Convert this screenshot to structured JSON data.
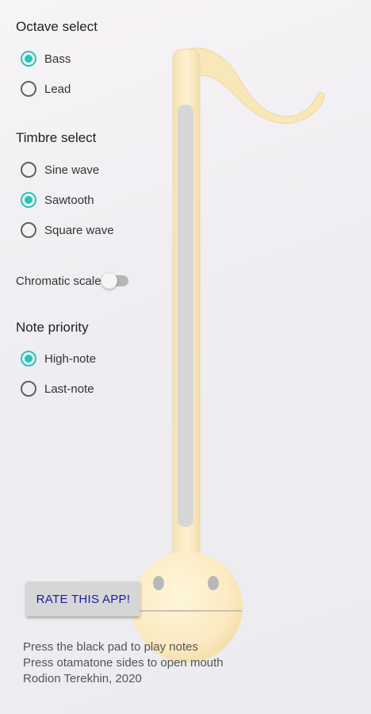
{
  "colors": {
    "accent": "#26c6b8",
    "button_text": "#1a1aa6",
    "otamatone_body": "#fbefcb",
    "stem_pad": "#d6d6d6"
  },
  "octave": {
    "title": "Octave select",
    "options": [
      {
        "label": "Bass",
        "checked": true
      },
      {
        "label": "Lead",
        "checked": false
      }
    ]
  },
  "timbre": {
    "title": "Timbre select",
    "options": [
      {
        "label": "Sine wave",
        "checked": false
      },
      {
        "label": "Sawtooth",
        "checked": true
      },
      {
        "label": "Square wave",
        "checked": false
      }
    ]
  },
  "chromatic": {
    "label": "Chromatic scale",
    "enabled": false
  },
  "priority": {
    "title": "Note priority",
    "options": [
      {
        "label": "High-note",
        "checked": true
      },
      {
        "label": "Last-note",
        "checked": false
      }
    ]
  },
  "rate_button": {
    "label": "RATE THIS APP!"
  },
  "footer": {
    "lines": [
      "Press the black pad to play notes",
      "Press otamatone sides to open mouth",
      "Rodion Terekhin, 2020"
    ]
  },
  "icons": {
    "illustration": "otamatone-illustration"
  }
}
